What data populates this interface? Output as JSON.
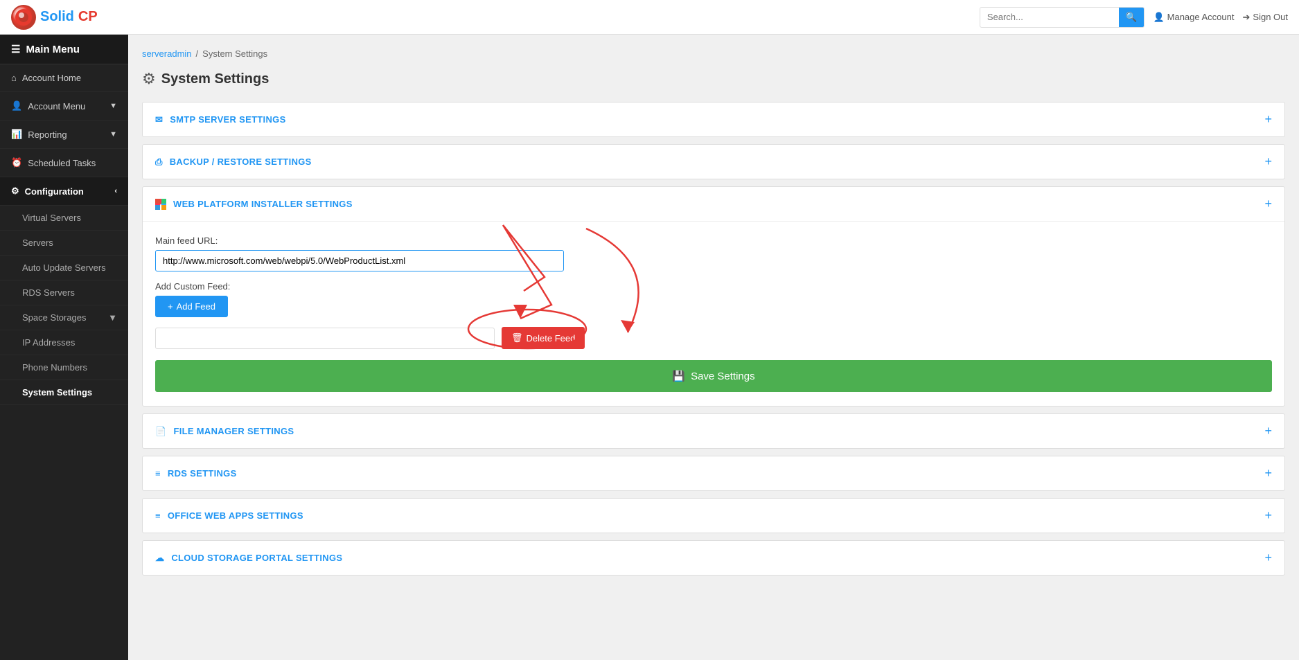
{
  "app": {
    "logo_solid": "Solid",
    "logo_cp": "CP",
    "title": "SolidCP"
  },
  "topbar": {
    "search_placeholder": "Search...",
    "search_btn_label": "🔍",
    "manage_account_label": "Manage Account",
    "sign_out_label": "Sign Out"
  },
  "sidebar": {
    "main_menu_label": "Main Menu",
    "items": [
      {
        "id": "account-home",
        "label": "Account Home",
        "icon": "home",
        "active": false
      },
      {
        "id": "account-menu",
        "label": "Account Menu",
        "icon": "user",
        "active": false,
        "expandable": true
      },
      {
        "id": "reporting",
        "label": "Reporting",
        "icon": "chart",
        "active": false,
        "expandable": true
      },
      {
        "id": "scheduled-tasks",
        "label": "Scheduled Tasks",
        "icon": "clock",
        "active": false
      },
      {
        "id": "configuration",
        "label": "Configuration",
        "icon": "cog",
        "active": true,
        "expandable": true
      },
      {
        "id": "virtual-servers",
        "label": "Virtual Servers",
        "sub": true
      },
      {
        "id": "servers",
        "label": "Servers",
        "sub": true
      },
      {
        "id": "auto-update-servers",
        "label": "Auto Update Servers",
        "sub": true
      },
      {
        "id": "rds-servers",
        "label": "RDS Servers",
        "sub": true
      },
      {
        "id": "space-storages",
        "label": "Space Storages",
        "sub": true,
        "expandable": true
      },
      {
        "id": "ip-addresses",
        "label": "IP Addresses",
        "sub": true
      },
      {
        "id": "phone-numbers",
        "label": "Phone Numbers",
        "sub": true
      },
      {
        "id": "system-settings",
        "label": "System Settings",
        "sub": true,
        "active": true
      }
    ]
  },
  "breadcrumb": {
    "items": [
      {
        "label": "serveradmin",
        "link": true
      },
      {
        "label": "/",
        "link": false
      },
      {
        "label": "System Settings",
        "link": false
      }
    ]
  },
  "page": {
    "title": "System Settings"
  },
  "sections": [
    {
      "id": "smtp",
      "icon": "envelope",
      "label": "SMTP SERVER SETTINGS",
      "expanded": false
    },
    {
      "id": "backup",
      "icon": "restore",
      "label": "BACKUP / RESTORE SETTINGS",
      "expanded": false
    },
    {
      "id": "webpi",
      "icon": "windows",
      "label": "WEB PLATFORM INSTALLER SETTINGS",
      "expanded": true,
      "content": {
        "main_feed_url_label": "Main feed URL:",
        "main_feed_url_value": "http://www.microsoft.com/web/webpi/5.0/WebProductList.xml",
        "add_custom_feed_label": "Add Custom Feed:",
        "add_feed_btn_label": "+ Add Feed",
        "custom_feed_placeholder": "",
        "delete_feed_btn_label": "Delete Feed",
        "save_settings_btn_label": "Save Settings"
      }
    },
    {
      "id": "filemanager",
      "icon": "file",
      "label": "FILE MANAGER SETTINGS",
      "expanded": false
    },
    {
      "id": "rds",
      "icon": "rds",
      "label": "RDS SETTINGS",
      "expanded": false
    },
    {
      "id": "officewebapps",
      "icon": "office",
      "label": "OFFICE WEB APPS SETTINGS",
      "expanded": false
    },
    {
      "id": "cloudstorage",
      "icon": "cloud",
      "label": "CLOUD STORAGE PORTAL SETTINGS",
      "expanded": false
    }
  ],
  "colors": {
    "accent_blue": "#2196f3",
    "sidebar_bg": "#222222",
    "topbar_bg": "#ffffff",
    "main_bg": "#f0f0f0",
    "save_green": "#4caf50",
    "delete_red": "#e53935"
  }
}
